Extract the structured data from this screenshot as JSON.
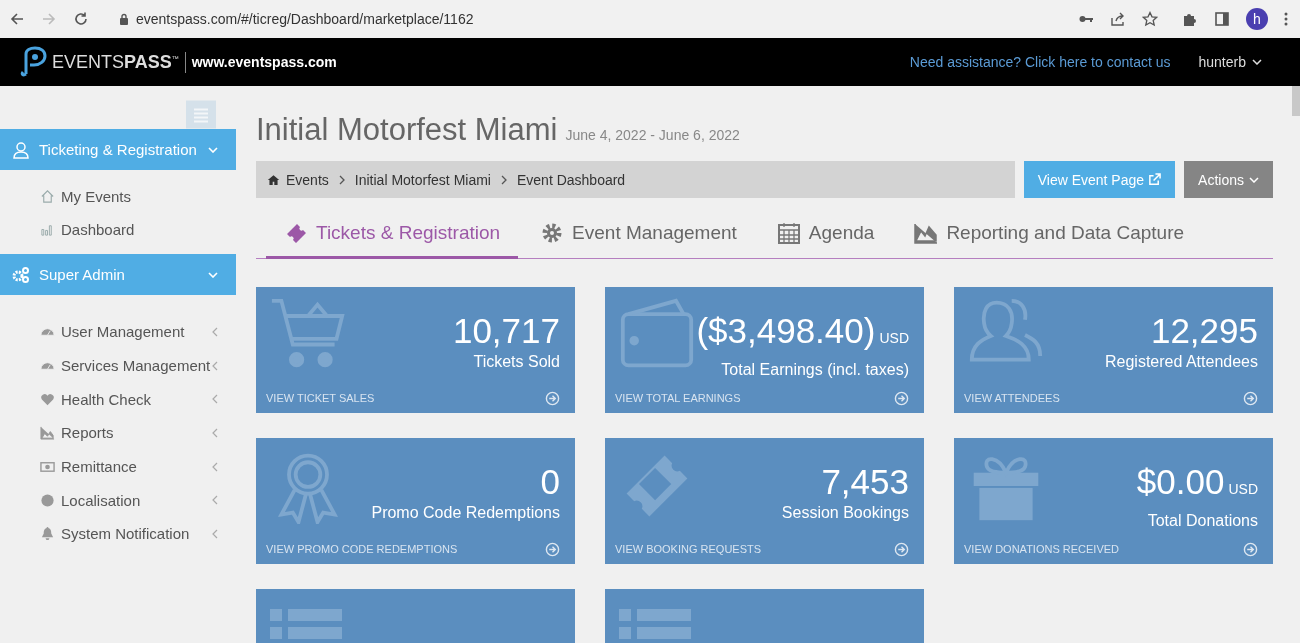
{
  "browser": {
    "url": "eventspass.com/#/ticreg/Dashboard/marketplace/1162",
    "profile_initial": "h"
  },
  "header": {
    "logo_light": "EVENTS",
    "logo_bold": "PASS",
    "logo_mark": "™",
    "site": "www.eventspass.com",
    "help_link": "Need assistance? Click here to contact us",
    "user": "hunterb"
  },
  "sidebar": {
    "sections": [
      {
        "label": "Ticketing & Registration",
        "expanded": true,
        "items": [
          {
            "label": "My Events",
            "kind": "link"
          },
          {
            "label": "Dashboard",
            "kind": "link"
          }
        ]
      },
      {
        "label": "Super Admin",
        "expanded": true,
        "items": [
          {
            "label": "User Management",
            "kind": "submenu"
          },
          {
            "label": "Services Management",
            "kind": "submenu"
          },
          {
            "label": "Health Check",
            "kind": "submenu"
          },
          {
            "label": "Reports",
            "kind": "submenu"
          },
          {
            "label": "Remittance",
            "kind": "submenu"
          },
          {
            "label": "Localisation",
            "kind": "submenu"
          },
          {
            "label": "System Notification",
            "kind": "submenu"
          }
        ]
      }
    ]
  },
  "event": {
    "title": "Initial Motorfest Miami",
    "dates": "June 4, 2022 - June 6, 2022"
  },
  "breadcrumb": [
    "Events",
    "Initial Motorfest Miami",
    "Event Dashboard"
  ],
  "buttons": {
    "view_event_page": "View Event Page",
    "actions": "Actions"
  },
  "tabs": [
    {
      "label": "Tickets & Registration",
      "selected": true
    },
    {
      "label": "Event Management",
      "selected": false
    },
    {
      "label": "Agenda",
      "selected": false
    },
    {
      "label": "Reporting and Data Capture",
      "selected": false
    }
  ],
  "cards": [
    {
      "kind": "stat",
      "value": "10,717",
      "label": "Tickets Sold",
      "link": "VIEW TICKET SALES"
    },
    {
      "kind": "stat",
      "value": "($3,498.40)",
      "unit": "USD",
      "label": "Total Earnings (incl. taxes)",
      "link": "VIEW TOTAL EARNINGS"
    },
    {
      "kind": "stat",
      "value": "12,295",
      "label": "Registered Attendees",
      "link": "VIEW ATTENDEES"
    },
    {
      "kind": "stat",
      "value": "0",
      "label": "Promo Code Redemptions",
      "link": "VIEW PROMO CODE REDEMPTIONS"
    },
    {
      "kind": "stat",
      "value": "7,453",
      "label": "Session Bookings",
      "link": "VIEW BOOKING REQUESTS"
    },
    {
      "kind": "stat",
      "value": "$0.00",
      "unit": "USD",
      "label": "Total Donations",
      "link": "VIEW DONATIONS RECEIVED"
    },
    {
      "kind": "cut"
    },
    {
      "kind": "cut"
    }
  ]
}
